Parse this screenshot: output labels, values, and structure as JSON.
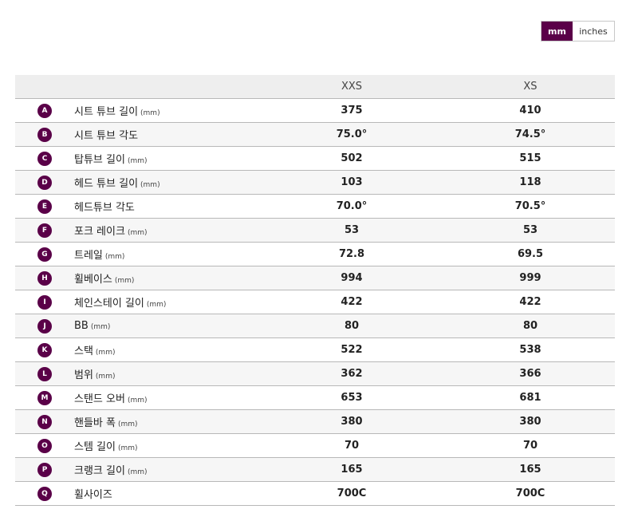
{
  "unit_toggle": {
    "mm_label": "mm",
    "inches_label": "inches",
    "selected": "mm",
    "accent": "#5a0048"
  },
  "table": {
    "columns": [
      "XXS",
      "XS"
    ],
    "rows": [
      {
        "key": "A",
        "label": "시트 튜브 길이",
        "unit": "(mm)",
        "xxs": "375",
        "xs": "410"
      },
      {
        "key": "B",
        "label": "시트 튜브 각도",
        "unit": "",
        "xxs": "75.0°",
        "xs": "74.5°"
      },
      {
        "key": "C",
        "label": "탑튜브 길이",
        "unit": "(mm)",
        "xxs": "502",
        "xs": "515"
      },
      {
        "key": "D",
        "label": "헤드 튜브 길이",
        "unit": "(mm)",
        "xxs": "103",
        "xs": "118"
      },
      {
        "key": "E",
        "label": "헤드튜브 각도",
        "unit": "",
        "xxs": "70.0°",
        "xs": "70.5°"
      },
      {
        "key": "F",
        "label": "포크 레이크",
        "unit": "(mm)",
        "xxs": "53",
        "xs": "53"
      },
      {
        "key": "G",
        "label": "트레일",
        "unit": "(mm)",
        "xxs": "72.8",
        "xs": "69.5"
      },
      {
        "key": "H",
        "label": "휠베이스",
        "unit": "(mm)",
        "xxs": "994",
        "xs": "999"
      },
      {
        "key": "I",
        "label": "체인스테이 길이",
        "unit": "(mm)",
        "xxs": "422",
        "xs": "422"
      },
      {
        "key": "J",
        "label": "BB",
        "unit": "(mm)",
        "xxs": "80",
        "xs": "80"
      },
      {
        "key": "K",
        "label": "스택",
        "unit": "(mm)",
        "xxs": "522",
        "xs": "538"
      },
      {
        "key": "L",
        "label": "범위",
        "unit": "(mm)",
        "xxs": "362",
        "xs": "366"
      },
      {
        "key": "M",
        "label": "스탠드 오버",
        "unit": "(mm)",
        "xxs": "653",
        "xs": "681"
      },
      {
        "key": "N",
        "label": "핸들바 폭",
        "unit": "(mm)",
        "xxs": "380",
        "xs": "380"
      },
      {
        "key": "O",
        "label": "스템 길이",
        "unit": "(mm)",
        "xxs": "70",
        "xs": "70"
      },
      {
        "key": "P",
        "label": "크랭크 길이",
        "unit": "(mm)",
        "xxs": "165",
        "xs": "165"
      },
      {
        "key": "Q",
        "label": "휠사이즈",
        "unit": "",
        "xxs": "700C",
        "xs": "700C"
      }
    ]
  }
}
